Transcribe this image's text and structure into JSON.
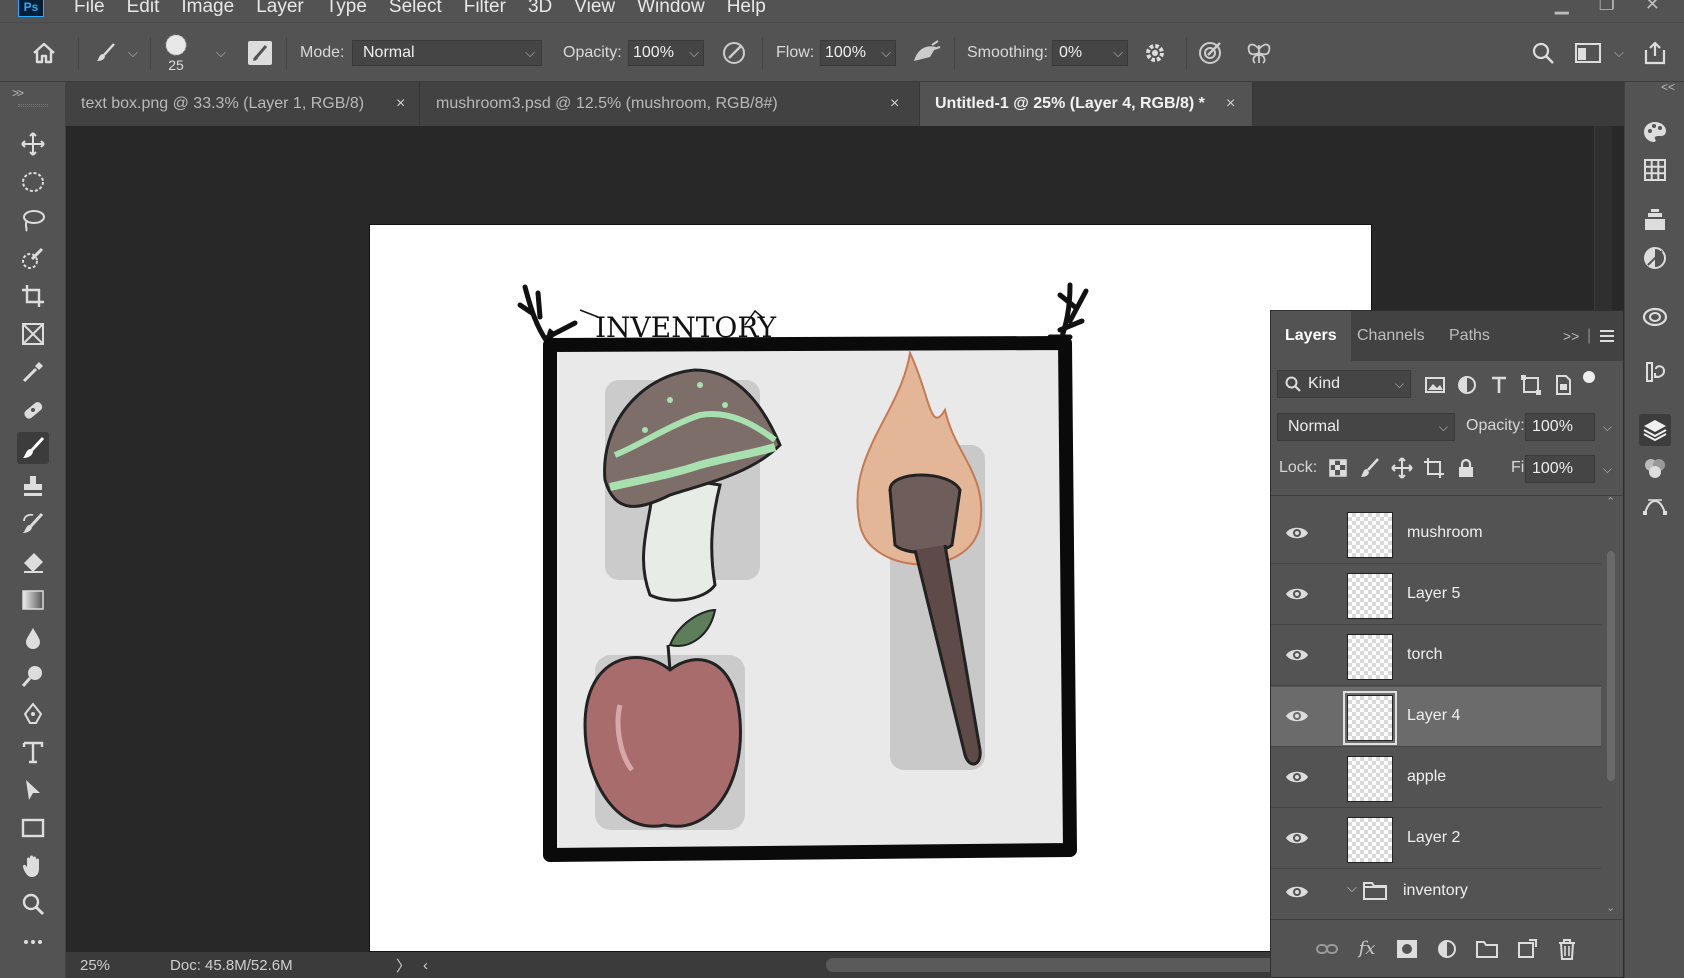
{
  "app": {
    "logo_text": "Ps"
  },
  "menubar": {
    "items": [
      "File",
      "Edit",
      "Image",
      "Layer",
      "Type",
      "Select",
      "Filter",
      "3D",
      "View",
      "Window",
      "Help"
    ]
  },
  "options": {
    "brush_size": "25",
    "mode_label": "Mode:",
    "mode_value": "Normal",
    "opacity_label": "Opacity:",
    "opacity_value": "100%",
    "flow_label": "Flow:",
    "flow_value": "100%",
    "smoothing_label": "Smoothing:",
    "smoothing_value": "0%"
  },
  "tabs": [
    {
      "label": "text box.png @ 33.3% (Layer 1, RGB/8)",
      "close": "×"
    },
    {
      "label": "mushroom3.psd @ 12.5% (mushroom, RGB/8#)",
      "close": "×"
    },
    {
      "label": "Untitled-1 @ 25% (Layer 4, RGB/8) *",
      "close": "×"
    }
  ],
  "artwork": {
    "title": "INVENTORY"
  },
  "status": {
    "zoom": "25%",
    "doc": "Doc: 45.8M/52.6M",
    "arrow": "〉",
    "left_arrow": "‹"
  },
  "layers_panel": {
    "tabs": [
      "Layers",
      "Channels",
      "Paths"
    ],
    "expand_glyph": ">>",
    "kind_value": "Kind",
    "blend_value": "Normal",
    "opacity_label": "Opacity:",
    "opacity_value": "100%",
    "lock_label": "Lock:",
    "fill_label": "Fill:",
    "fill_value": "100%",
    "layers": [
      {
        "name": "mushroom",
        "selected": false
      },
      {
        "name": "Layer 5",
        "selected": false
      },
      {
        "name": "torch",
        "selected": false
      },
      {
        "name": "Layer 4",
        "selected": true
      },
      {
        "name": "apple",
        "selected": false
      },
      {
        "name": "Layer 2",
        "selected": false
      }
    ],
    "group": {
      "name": "inventory"
    },
    "footer_fx": "fx"
  },
  "colors": {
    "accent": "#31a8ff",
    "panel": "#535353",
    "canvas_bg": "#282828"
  }
}
